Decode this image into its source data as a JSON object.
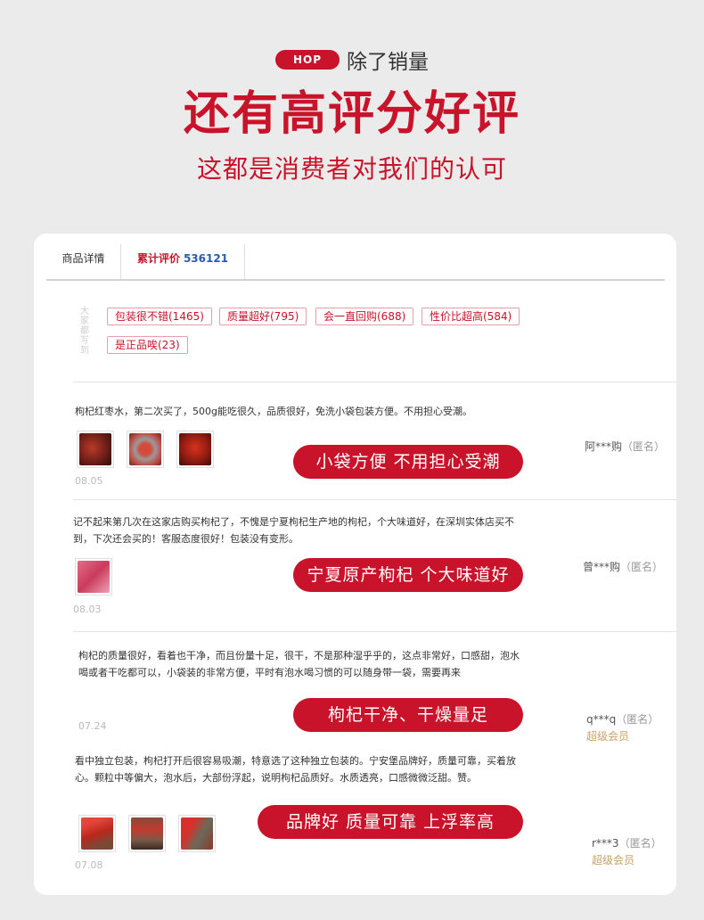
{
  "header": {
    "badge": "HOP",
    "subtitle": "除了销量",
    "title": "还有高评分好评",
    "tagline": "这都是消费者对我们的认可"
  },
  "tabs": {
    "detail": "商品详情",
    "reviews_label": "累计评价",
    "reviews_count": "536121"
  },
  "impressions": {
    "label": "大家都写到",
    "tags": [
      "包装很不错(1465)",
      "质量超好(795)",
      "会一直回购(688)",
      "性价比超高(584)",
      "是正品唉(23)"
    ]
  },
  "reviews": [
    {
      "text": "枸杞红枣水，第二次买了，500g能吃很久，品质很好，免洗小袋包装方便。不用担心受潮。",
      "highlight": "小袋方便 不用担心受潮",
      "date": "08.05",
      "user": "阿***购",
      "anon": "（匿名）",
      "vip": "",
      "thumbs": 3
    },
    {
      "text": "记不起来第几次在这家店购买枸杞了，不愧是宁夏枸杞生产地的枸杞，个大味道好，在深圳实体店买不到，下次还会买的！客服态度很好！包装没有变形。",
      "highlight": "宁夏原产枸杞 个大味道好",
      "date": "08.03",
      "user": "曾***购",
      "anon": "（匿名）",
      "vip": "",
      "thumbs": 1
    },
    {
      "text": "枸杞的质量很好，看着也干净，而且份量十足，很干，不是那种湿乎乎的，这点非常好，口感甜，泡水喝或者干吃都可以，小袋装的非常方便，平时有泡水喝习惯的可以随身带一袋，需要再来",
      "highlight": "枸杞干净、干燥量足",
      "date": "07.24",
      "user": "q***q",
      "anon": "（匿名）",
      "vip": "超级会员",
      "thumbs": 0
    },
    {
      "text": "看中独立包装，枸杞打开后很容易吸潮，特意选了这种独立包装的。宁安堡品牌好，质量可靠，买着放心。颗粒中等偏大，泡水后，大部份浮起，说明枸杞品质好。水质透亮，口感微微泛甜。赞。",
      "highlight": "品牌好 质量可靠 上浮率高",
      "date": "07.08",
      "user": "r***3",
      "anon": "（匿名）",
      "vip": "超级会员",
      "thumbs": 3
    }
  ],
  "colors": {
    "brand_red": "#c8132a",
    "count_blue": "#2b5bb0",
    "vip_gold": "#c9a06a"
  }
}
